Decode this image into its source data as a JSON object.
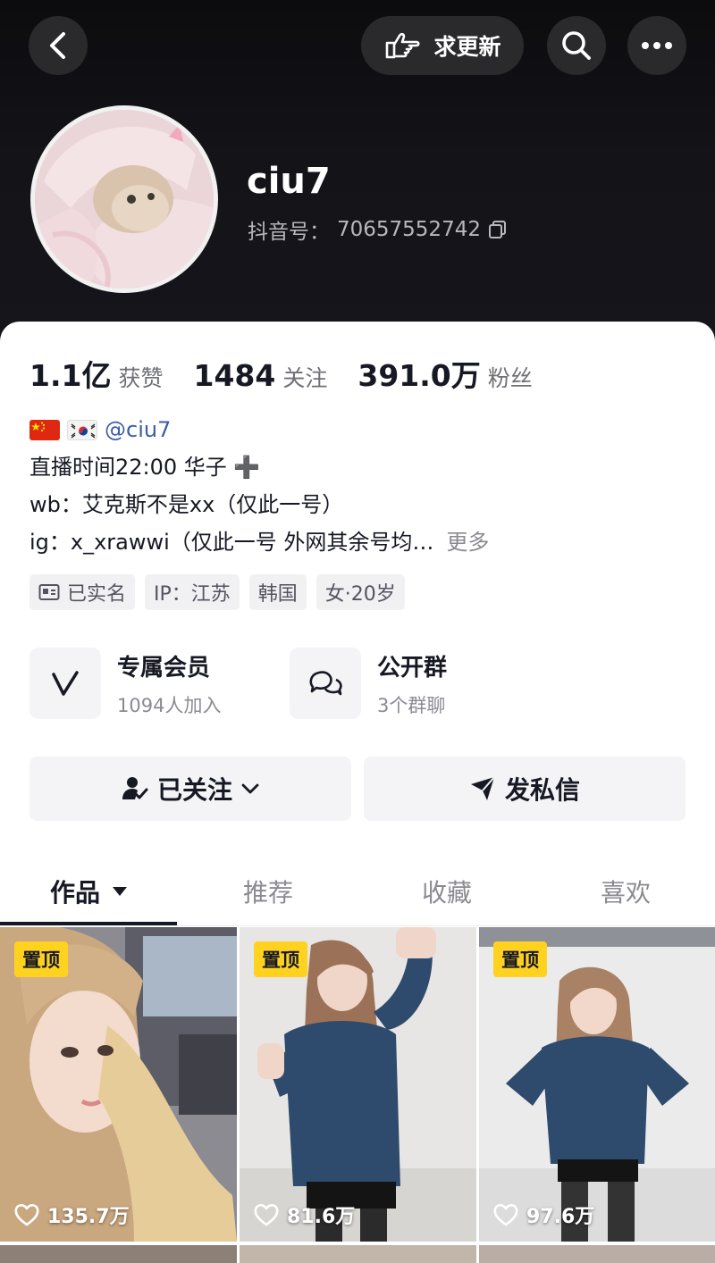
{
  "header": {
    "update_label": "求更新",
    "username": "ciu7",
    "douyin_id_label": "抖音号：",
    "douyin_id": "70657552742"
  },
  "stats": [
    {
      "num": "1.1亿",
      "label": "获赞"
    },
    {
      "num": "1484",
      "label": "关注"
    },
    {
      "num": "391.0万",
      "label": "粉丝"
    }
  ],
  "bio": {
    "mention": "@ciu7",
    "line1": "直播时间22:00 华子 ➕",
    "line2": "wb：艾克斯不是xx（仅此一号）",
    "line3": "ig：x_xrawwi（仅此一号 外网其余号均…",
    "more": "更多"
  },
  "tags": [
    "已实名",
    "IP：江苏",
    "韩国",
    "女·20岁"
  ],
  "features": [
    {
      "title": "专属会员",
      "subtitle": "1094人加入"
    },
    {
      "title": "公开群",
      "subtitle": "3个群聊"
    }
  ],
  "actions": {
    "follow": "已关注",
    "message": "发私信"
  },
  "tabs": [
    "作品",
    "推荐",
    "收藏",
    "喜欢"
  ],
  "videos": [
    {
      "pin": "置顶",
      "likes": "135.7万"
    },
    {
      "pin": "置顶",
      "likes": "81.6万"
    },
    {
      "pin": "置顶",
      "likes": "97.6万"
    }
  ],
  "colors": {
    "header_bg": "#131318",
    "pin_badge": "#ffd21f",
    "mention": "#3a5ea6",
    "text": "#161823"
  }
}
